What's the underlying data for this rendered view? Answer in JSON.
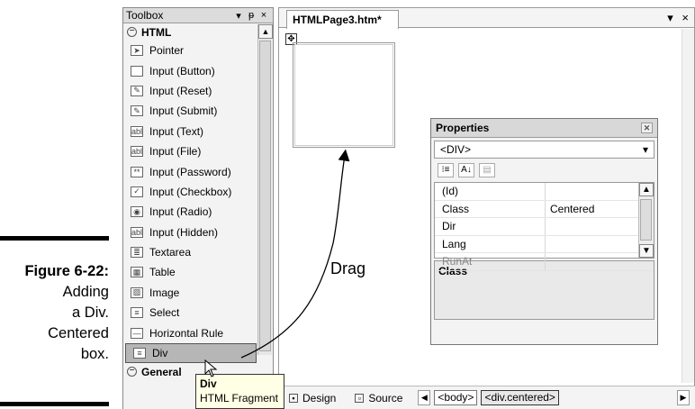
{
  "caption": {
    "figure_label": "Figure 6-22:",
    "lines": [
      "Adding",
      "a Div.",
      "Centered",
      "box."
    ]
  },
  "toolbox": {
    "title": "Toolbox",
    "controls": [
      "▾",
      "ᵽ",
      "×"
    ],
    "group_html": "HTML",
    "items": [
      {
        "label": "Pointer",
        "icon": "pointer-icon",
        "glyph": "➤"
      },
      {
        "label": "Input (Button)",
        "icon": "button-icon",
        "glyph": " "
      },
      {
        "label": "Input (Reset)",
        "icon": "reset-icon",
        "glyph": "✎"
      },
      {
        "label": "Input (Submit)",
        "icon": "submit-icon",
        "glyph": "✎"
      },
      {
        "label": "Input (Text)",
        "icon": "text-field-icon",
        "glyph": "abl"
      },
      {
        "label": "Input (File)",
        "icon": "file-field-icon",
        "glyph": "abl"
      },
      {
        "label": "Input (Password)",
        "icon": "password-icon",
        "glyph": "**"
      },
      {
        "label": "Input (Checkbox)",
        "icon": "checkbox-icon",
        "glyph": "✓"
      },
      {
        "label": "Input (Radio)",
        "icon": "radio-icon",
        "glyph": "◉"
      },
      {
        "label": "Input (Hidden)",
        "icon": "hidden-field-icon",
        "glyph": "abl"
      },
      {
        "label": "Textarea",
        "icon": "textarea-icon",
        "glyph": "≣"
      },
      {
        "label": "Table",
        "icon": "table-icon",
        "glyph": "▦"
      },
      {
        "label": "Image",
        "icon": "image-icon",
        "glyph": "▨"
      },
      {
        "label": "Select",
        "icon": "select-icon",
        "glyph": "≡"
      },
      {
        "label": "Horizontal Rule",
        "icon": "hr-icon",
        "glyph": "—"
      },
      {
        "label": "Div",
        "icon": "div-icon",
        "glyph": "≡",
        "selected": true
      }
    ],
    "group_general": "General",
    "tooltip": {
      "title": "Div",
      "subtitle": "HTML Fragment"
    }
  },
  "document": {
    "tab": "HTMLPage3.htm*",
    "close": "×",
    "menu": "▾",
    "move_handle": "✥"
  },
  "drag_label": "Drag",
  "properties": {
    "title": "Properties",
    "close": "✕",
    "selector_value": "<DIV>",
    "toolbar": [
      "⁝≡",
      "A↓",
      "▤"
    ],
    "rows": [
      {
        "name": "(Id)",
        "value": ""
      },
      {
        "name": "Class",
        "value": "Centered"
      },
      {
        "name": "Dir",
        "value": ""
      },
      {
        "name": "Lang",
        "value": ""
      },
      {
        "name": "RunAt",
        "value": "",
        "dim": true
      }
    ],
    "description": "Class"
  },
  "status": {
    "design": "Design",
    "source": "Source",
    "crumbs": [
      "<body>",
      "<div.centered>"
    ]
  }
}
